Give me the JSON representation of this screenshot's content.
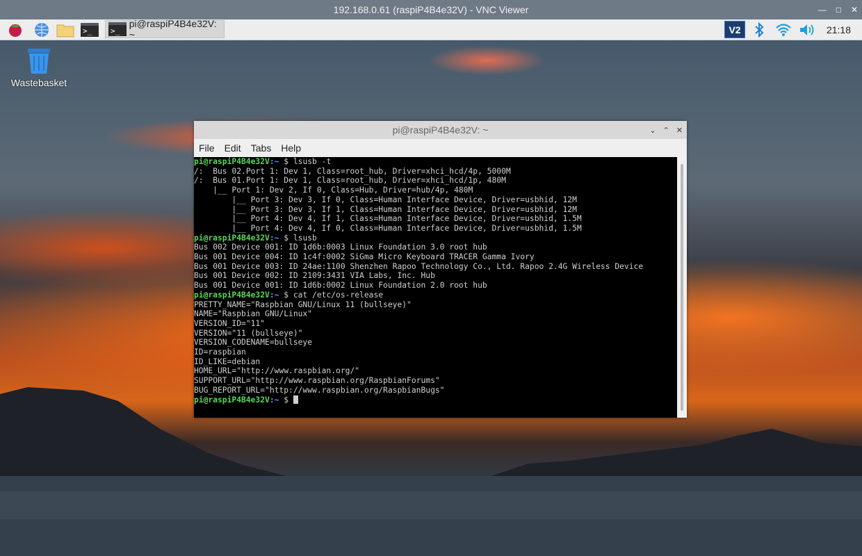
{
  "vnc": {
    "title": "192.168.0.61 (raspiP4B4e32V) - VNC Viewer"
  },
  "taskbar": {
    "task_label": "pi@raspiP4B4e32V: ~",
    "clock": "21:18",
    "icons": [
      "raspberry-menu-icon",
      "web-browser-icon",
      "file-manager-icon",
      "terminal-icon",
      "vnc-icon",
      "bluetooth-icon",
      "wifi-icon",
      "volume-icon"
    ]
  },
  "desktop": {
    "wastebasket_label": "Wastebasket"
  },
  "terminal": {
    "title": "pi@raspiP4B4e32V: ~",
    "menu": [
      "File",
      "Edit",
      "Tabs",
      "Help"
    ],
    "prompt_user": "pi@raspiP4B4e32V",
    "prompt_path": ":~",
    "prompt_dollar": " $ ",
    "lines": [
      {
        "type": "cmd",
        "text": "lsusb -t"
      },
      {
        "type": "out",
        "text": "/:  Bus 02.Port 1: Dev 1, Class=root_hub, Driver=xhci_hcd/4p, 5000M"
      },
      {
        "type": "out",
        "text": "/:  Bus 01.Port 1: Dev 1, Class=root_hub, Driver=xhci_hcd/1p, 480M"
      },
      {
        "type": "out",
        "text": "    |__ Port 1: Dev 2, If 0, Class=Hub, Driver=hub/4p, 480M"
      },
      {
        "type": "out",
        "text": "        |__ Port 3: Dev 3, If 0, Class=Human Interface Device, Driver=usbhid, 12M"
      },
      {
        "type": "out",
        "text": "        |__ Port 3: Dev 3, If 1, Class=Human Interface Device, Driver=usbhid, 12M"
      },
      {
        "type": "out",
        "text": "        |__ Port 4: Dev 4, If 1, Class=Human Interface Device, Driver=usbhid, 1.5M"
      },
      {
        "type": "out",
        "text": "        |__ Port 4: Dev 4, If 0, Class=Human Interface Device, Driver=usbhid, 1.5M"
      },
      {
        "type": "cmd",
        "text": "lsusb"
      },
      {
        "type": "out",
        "text": "Bus 002 Device 001: ID 1d6b:0003 Linux Foundation 3.0 root hub"
      },
      {
        "type": "out",
        "text": "Bus 001 Device 004: ID 1c4f:0002 SiGma Micro Keyboard TRACER Gamma Ivory"
      },
      {
        "type": "out",
        "text": "Bus 001 Device 003: ID 24ae:1100 Shenzhen Rapoo Technology Co., Ltd. Rapoo 2.4G Wireless Device"
      },
      {
        "type": "out",
        "text": "Bus 001 Device 002: ID 2109:3431 VIA Labs, Inc. Hub"
      },
      {
        "type": "out",
        "text": "Bus 001 Device 001: ID 1d6b:0002 Linux Foundation 2.0 root hub"
      },
      {
        "type": "cmd",
        "text": "cat /etc/os-release"
      },
      {
        "type": "out",
        "text": "PRETTY_NAME=\"Raspbian GNU/Linux 11 (bullseye)\""
      },
      {
        "type": "out",
        "text": "NAME=\"Raspbian GNU/Linux\""
      },
      {
        "type": "out",
        "text": "VERSION_ID=\"11\""
      },
      {
        "type": "out",
        "text": "VERSION=\"11 (bullseye)\""
      },
      {
        "type": "out",
        "text": "VERSION_CODENAME=bullseye"
      },
      {
        "type": "out",
        "text": "ID=raspbian"
      },
      {
        "type": "out",
        "text": "ID_LIKE=debian"
      },
      {
        "type": "out",
        "text": "HOME_URL=\"http://www.raspbian.org/\""
      },
      {
        "type": "out",
        "text": "SUPPORT_URL=\"http://www.raspbian.org/RaspbianForums\""
      },
      {
        "type": "out",
        "text": "BUG_REPORT_URL=\"http://www.raspbian.org/RaspbianBugs\""
      },
      {
        "type": "cmd",
        "text": ""
      }
    ]
  }
}
